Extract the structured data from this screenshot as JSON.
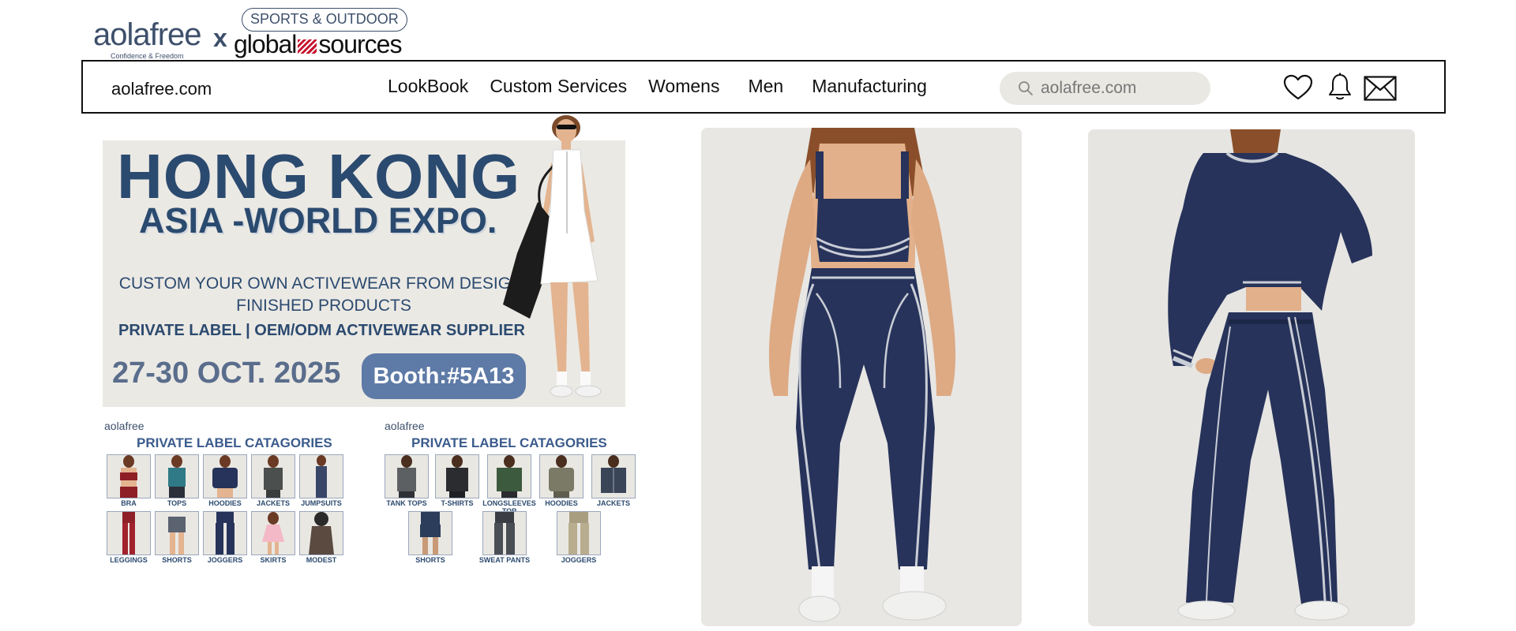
{
  "logos": {
    "brand": "aolafree",
    "tagline": "Confidence & Freedom",
    "separator": "x",
    "partner_pill": "SPORTS & OUTDOOR",
    "partner_name_part1": "global",
    "partner_name_part2": "sources"
  },
  "navbar": {
    "domain": "aolafree.com",
    "links": [
      "LookBook",
      "Custom Services",
      "Womens",
      "Men",
      "Manufacturing"
    ],
    "search_placeholder": "aolafree.com",
    "icons": [
      "heart-icon",
      "bell-icon",
      "mail-icon"
    ]
  },
  "banner": {
    "title": "HONG KONG",
    "subtitle": "ASIA -WORLD EXPO.",
    "line1": "CUSTOM YOUR OWN ACTIVEWEAR FROM DESIGN-FINISHED PRODUCTS",
    "line2": "PRIVATE LABEL  | OEM/ODM ACTIVEWEAR SUPPLIER",
    "dates": "27-30 OCT. 2025",
    "booth": "Booth:#5A13"
  },
  "category_boards": [
    {
      "logo": "aolafree",
      "title": "PRIVATE LABEL CATAGORIES",
      "items": [
        "BRA",
        "TOPS",
        "HOODIES",
        "JACKETS",
        "JUMPSUITS",
        "LEGGINGS",
        "SHORTS",
        "JOGGERS",
        "SKIRTS",
        "MODEST"
      ]
    },
    {
      "logo": "aolafree",
      "title": "PRIVATE LABEL CATAGORIES",
      "items": [
        "TANK TOPS",
        "T-SHIRTS",
        "LONGSLEEVES TOP",
        "HOODIES",
        "JACKETS",
        "SHORTS",
        "SWEAT PANTS",
        "JOGGERS"
      ]
    }
  ],
  "colors": {
    "navy_text": "#2b4a6f",
    "booth_button": "#5e7aa6",
    "garment_navy": "#27335a",
    "piping": "#c9cdd6",
    "banner_bg": "#ebe9e4",
    "search_bg": "#e9e8e3"
  }
}
